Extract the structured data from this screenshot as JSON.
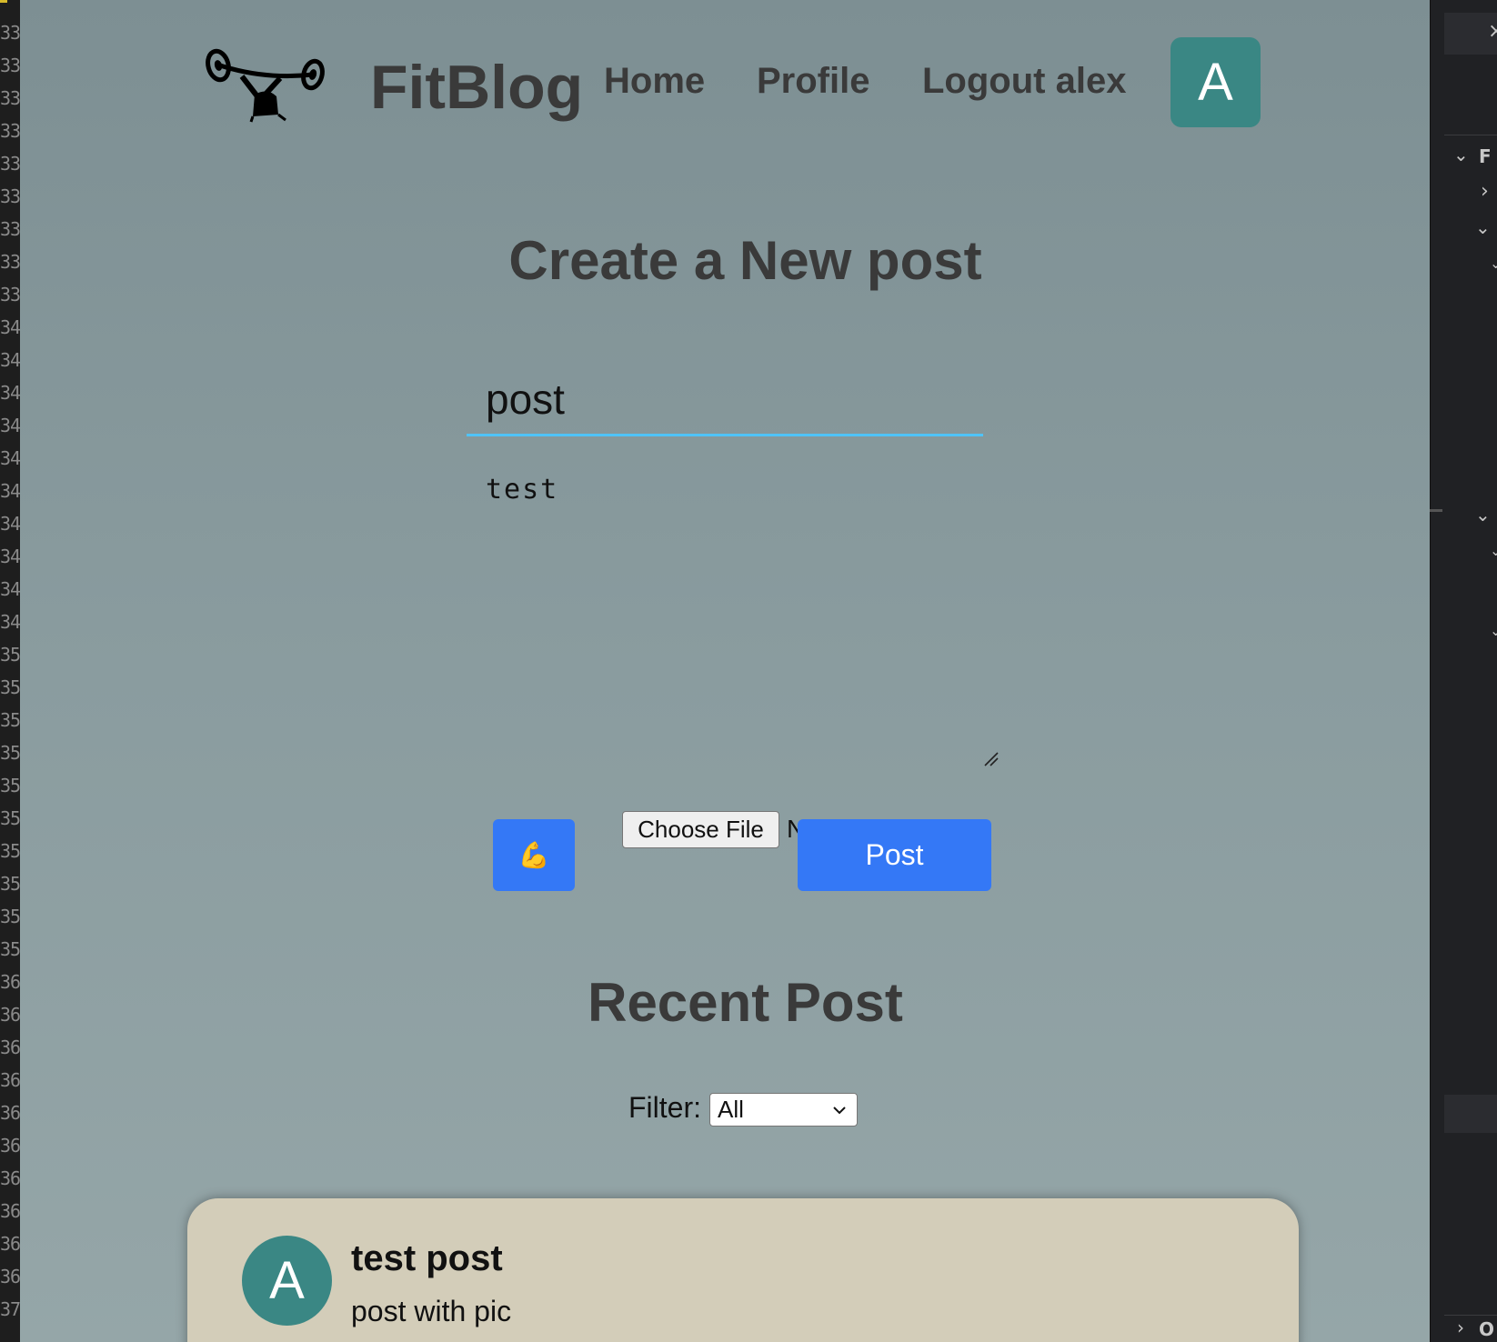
{
  "editor": {
    "line_numbers": [
      "33",
      "33",
      "33",
      "33",
      "33",
      "33",
      "33",
      "33",
      "33",
      "34",
      "34",
      "34",
      "34",
      "34",
      "34",
      "34",
      "34",
      "34",
      "34",
      "35",
      "35",
      "35",
      "35",
      "35",
      "35",
      "35",
      "35",
      "35",
      "35",
      "36",
      "36",
      "36",
      "36",
      "36",
      "36",
      "36",
      "36",
      "36",
      "36",
      "37"
    ]
  },
  "nav": {
    "brand": "FitBlog",
    "links": [
      "Home",
      "Profile",
      "Logout alex"
    ],
    "avatar_letter": "A"
  },
  "create": {
    "heading": "Create a New post",
    "title_value": "post",
    "body_value": "test",
    "emoji_label": "💪",
    "choose_file_label": "Choose File",
    "file_status": "N",
    "post_label": "Post"
  },
  "recent": {
    "heading": "Recent Post",
    "filter_label": "Filter:",
    "filter_value": "All",
    "posts": [
      {
        "avatar_letter": "A",
        "title": "test post",
        "body": "post with pic"
      }
    ]
  },
  "colors": {
    "accent": "#3478f6",
    "avatar": "#3a8784",
    "card": "#d3cdb9",
    "input_underline": "#4fc3f7"
  }
}
